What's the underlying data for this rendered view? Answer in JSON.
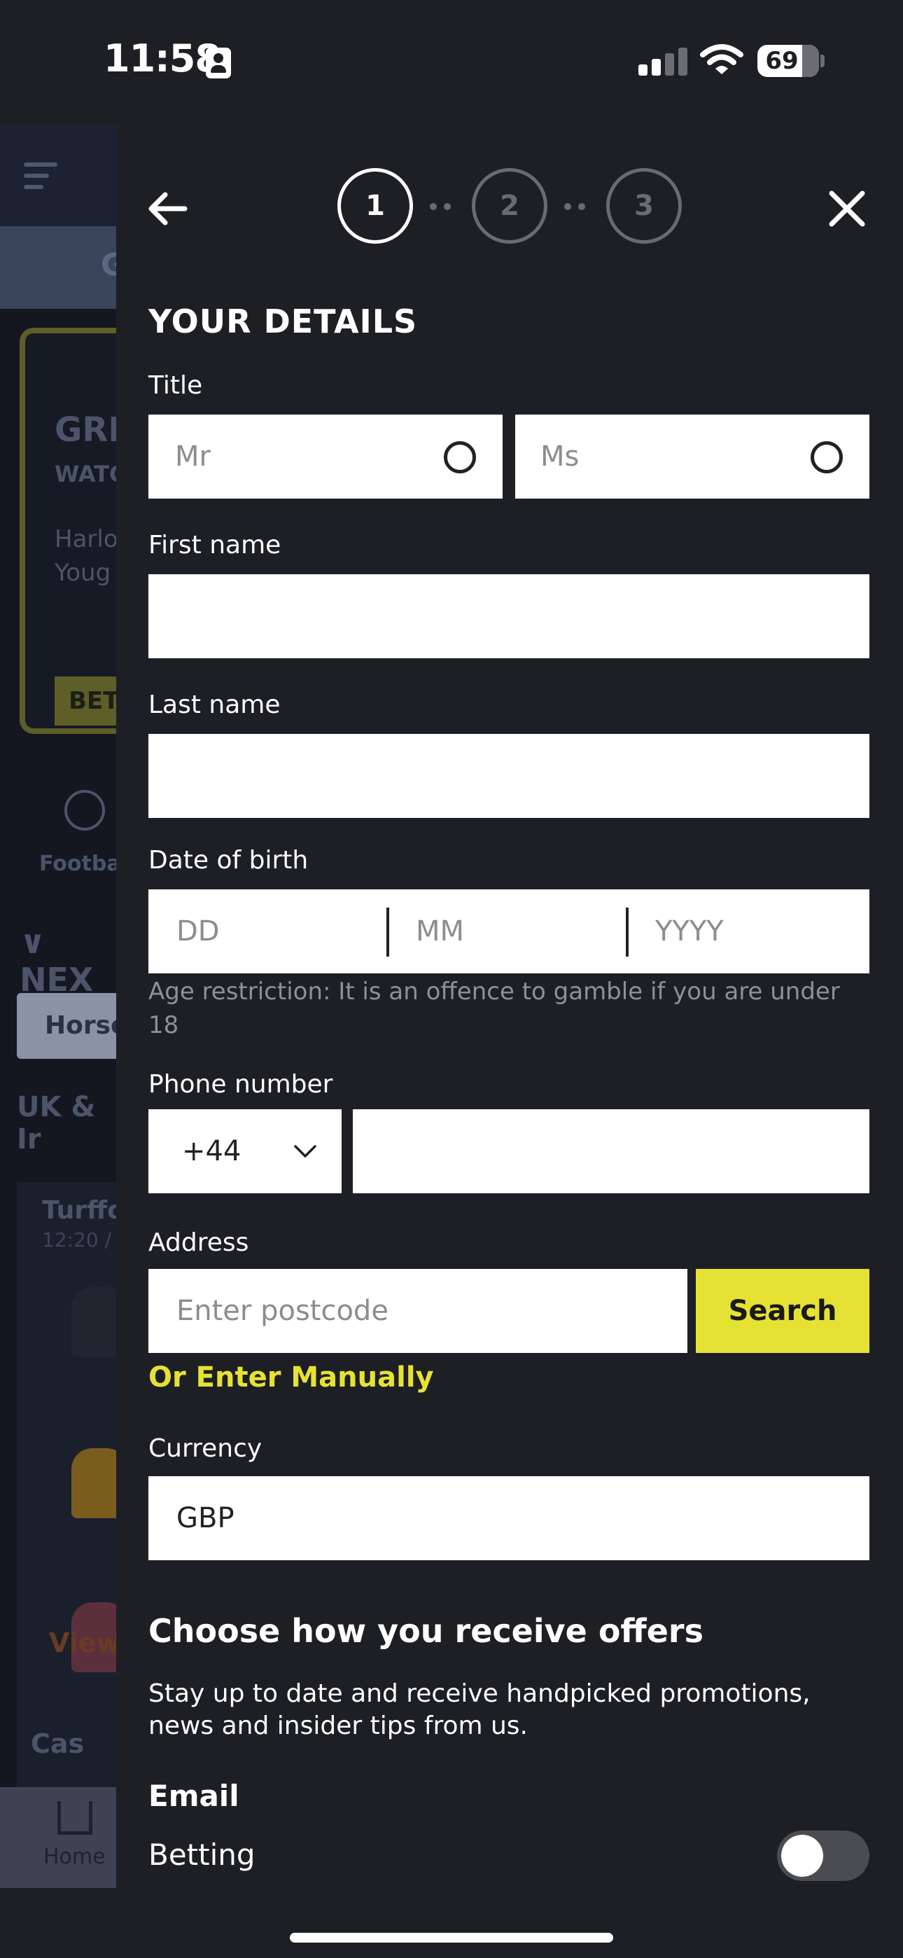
{
  "status_bar": {
    "time": "11:58",
    "battery": "69"
  },
  "background_app": {
    "tab_text": "G",
    "card_title": "GRE",
    "card_subtitle": "WATC",
    "card_text": "Harlo\nYoug",
    "card_button": "BET",
    "sport_label": "Footba",
    "section_title": "NEX",
    "horse_tab": "Horse",
    "region": "UK & Ir",
    "race_title": "Turffo",
    "race_sub": "12:20 /",
    "view_link": "View",
    "casino_label": "Cas",
    "nav_home": "Home"
  },
  "stepper": {
    "steps": [
      "1",
      "2",
      "3"
    ],
    "active_step": 1
  },
  "form": {
    "heading": "YOUR DETAILS",
    "title_label": "Title",
    "title_options": [
      "Mr",
      "Ms"
    ],
    "first_name_label": "First name",
    "last_name_label": "Last name",
    "dob_label": "Date of birth",
    "dob_placeholders": {
      "day": "DD",
      "month": "MM",
      "year": "YYYY"
    },
    "age_note": "Age restriction: It is an offence to gamble if you are under 18",
    "phone_label": "Phone number",
    "phone_code": "+44",
    "address_label": "Address",
    "postcode_placeholder": "Enter postcode",
    "search_button": "Search",
    "manual_link": "Or Enter Manually",
    "currency_label": "Currency",
    "currency_value": "GBP"
  },
  "offers": {
    "title": "Choose how you receive offers",
    "description": "Stay up to date and receive handpicked promotions, news and insider tips from us.",
    "email_label": "Email",
    "betting_label": "Betting",
    "betting_enabled": false
  },
  "colors": {
    "accent": "#e6e234",
    "background": "#1d1f25"
  }
}
